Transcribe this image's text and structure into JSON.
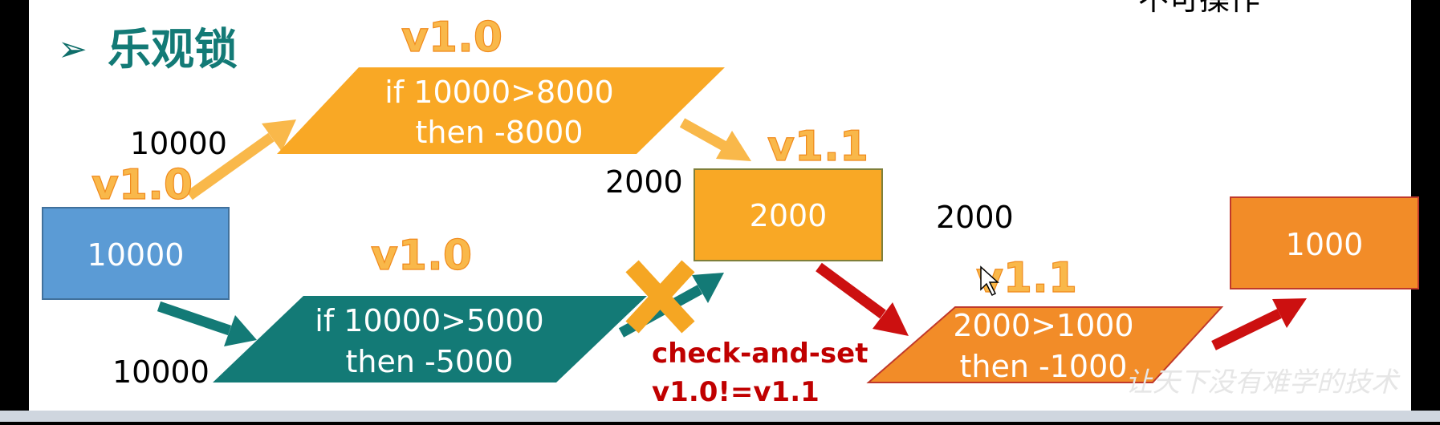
{
  "slide": {
    "top_right_text": "不可操作",
    "bullet": "➢",
    "title": "乐观锁",
    "watermark": "让天下没有难学的技术"
  },
  "colors": {
    "blue": "#5b9bd5",
    "yellow": "#f9a825",
    "teal": "#137a76",
    "orange": "#f28c28",
    "red": "#cc1010",
    "cross": "#f5a623"
  },
  "diagram": {
    "start_box": "10000",
    "start_version": "v1.0",
    "upper_read_value": "10000",
    "upper_op_version": "v1.0",
    "upper_op_line1": "if 10000>8000",
    "upper_op_line2": "then -8000",
    "lower_read_value": "10000",
    "lower_op_version": "v1.0",
    "lower_op_line1": "if 10000>5000",
    "lower_op_line2": "then -5000",
    "mid_result_label": "2000",
    "mid_version": "v1.1",
    "mid_box": "2000",
    "cas_line1": "check-and-set",
    "cas_line2": "v1.0!=v1.1",
    "right_read_value": "2000",
    "right_op_version": "v1.1",
    "right_op_line1": "2000>1000",
    "right_op_line2": "then -1000",
    "final_box": "1000"
  }
}
